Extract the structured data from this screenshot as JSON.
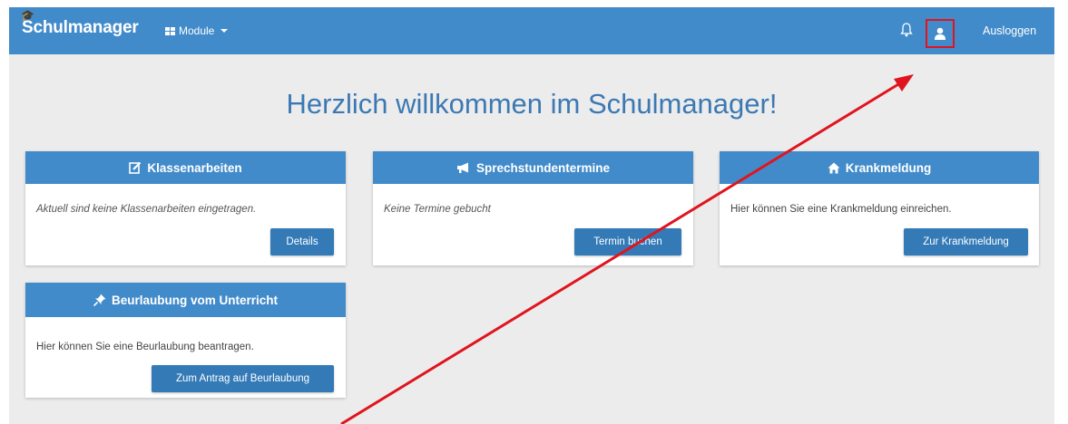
{
  "navbar": {
    "brand": "Schulmanager",
    "modules_label": "Module",
    "logout_label": "Ausloggen"
  },
  "welcome": {
    "title": "Herzlich willkommen im Schulmanager!"
  },
  "cards": {
    "klassenarbeiten": {
      "title": "Klassenarbeiten",
      "text": "Aktuell sind keine Klassenarbeiten eingetragen.",
      "button": "Details",
      "icon": "edit-icon"
    },
    "sprechstunden": {
      "title": "Sprechstundentermine",
      "text": "Keine Termine gebucht",
      "button": "Termin buchen",
      "icon": "megaphone-icon"
    },
    "krankmeldung": {
      "title": "Krankmeldung",
      "text": "Hier können Sie eine Krankmeldung einreichen.",
      "button": "Zur Krankmeldung",
      "icon": "home-icon"
    },
    "beurlaubung": {
      "title": "Beurlaubung vom Unterricht",
      "text": "Hier können Sie eine Beurlaubung beantragen.",
      "button": "Zum Antrag auf Beurlaubung",
      "icon": "pushpin-icon"
    }
  },
  "colors": {
    "primary": "#428bca",
    "button": "#337ab7",
    "heading": "#3c79b3",
    "annotation": "#e0141e",
    "background": "#ececec"
  }
}
